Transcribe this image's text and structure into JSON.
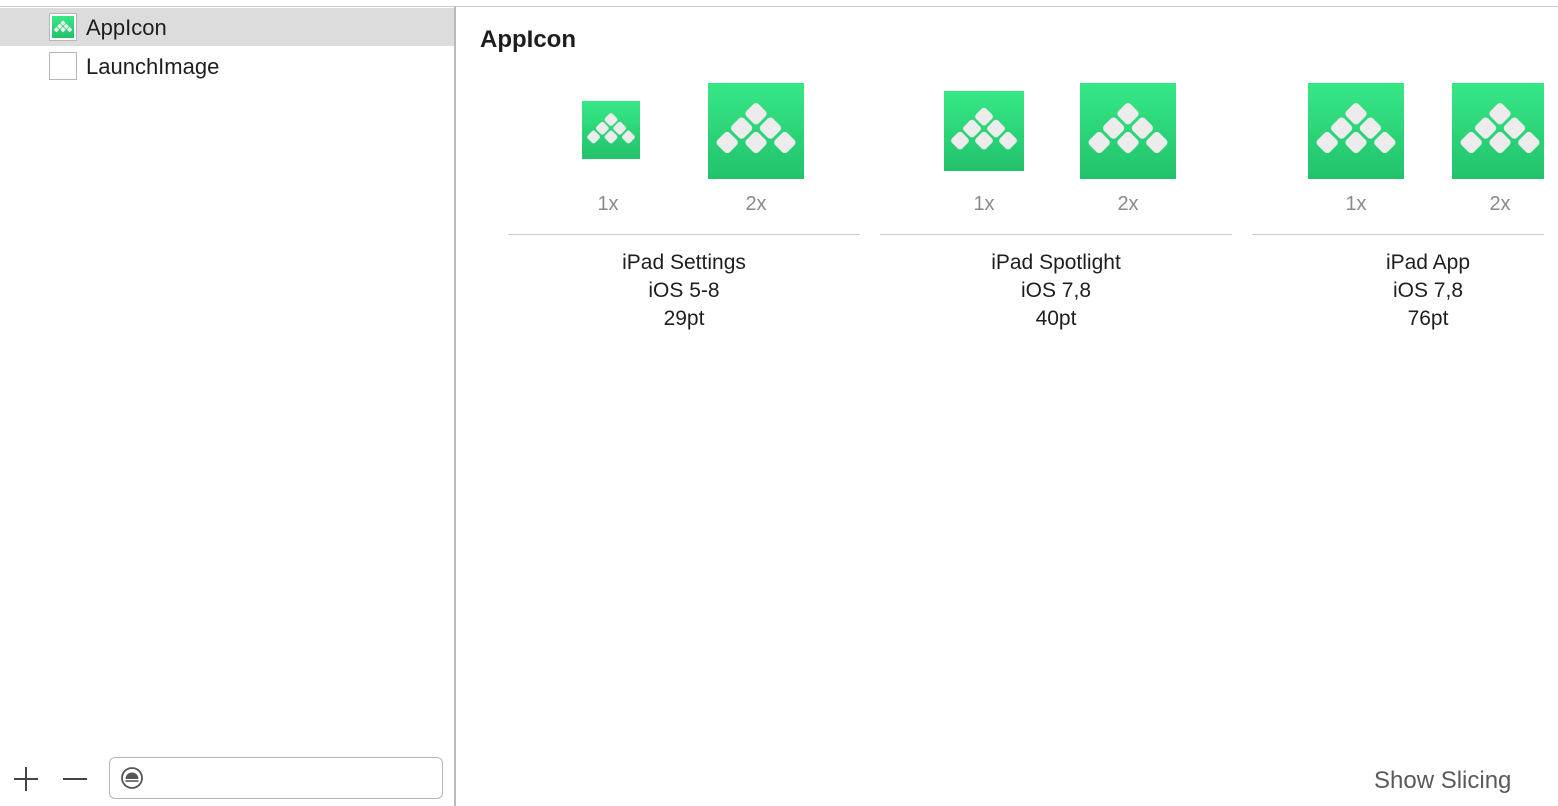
{
  "sidebar": {
    "items": [
      {
        "label": "AppIcon",
        "selected": true,
        "thumb": "green-appicon"
      },
      {
        "label": "LaunchImage",
        "selected": false,
        "thumb": "empty"
      }
    ],
    "add_icon": "plus-icon",
    "remove_icon": "minus-icon",
    "filter": {
      "icon": "filter-icon",
      "value": "",
      "placeholder": ""
    }
  },
  "main": {
    "title": "AppIcon",
    "groups": [
      {
        "scales": [
          "1x",
          "2x"
        ],
        "line1": "iPad Settings",
        "line2": "iOS 5-8",
        "line3": "29pt"
      },
      {
        "scales": [
          "1x",
          "2x"
        ],
        "line1": "iPad Spotlight",
        "line2": "iOS 7,8",
        "line3": "40pt"
      },
      {
        "scales": [
          "1x",
          "2x"
        ],
        "line1": "iPad App",
        "line2": "iOS 7,8",
        "line3": "76pt"
      }
    ],
    "show_slicing": "Show Slicing"
  },
  "colors": {
    "icon_green_top": "#36e886",
    "icon_green_bottom": "#22c26b",
    "selection": "#dcdcdc"
  }
}
